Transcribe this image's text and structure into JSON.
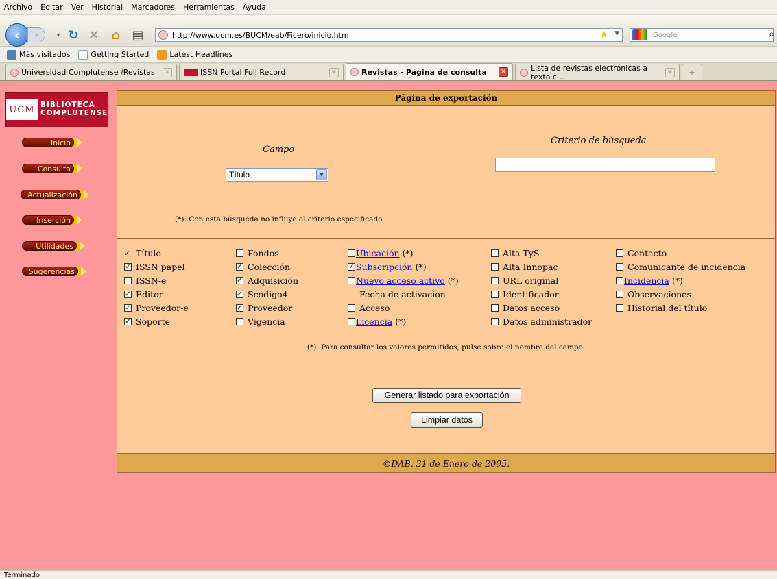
{
  "browser": {
    "menu": [
      "Archivo",
      "Editar",
      "Ver",
      "Historial",
      "Marcadores",
      "Herramientas",
      "Ayuda"
    ],
    "url": "http://www.ucm.es/BUCM/eab/Ficero/inicio.htm",
    "search_placeholder": "Google",
    "bookmarks": [
      "Más visitados",
      "Getting Started",
      "Latest Headlines"
    ],
    "tabs": [
      {
        "label": "Universidad Complutense /Revistas",
        "active": false
      },
      {
        "label": "ISSN Portal Full Record",
        "active": false
      },
      {
        "label": "Revistas - Página de consulta",
        "active": true
      },
      {
        "label": "Lista de revistas electrónicas a texto c...",
        "active": false
      }
    ],
    "status": "Terminado"
  },
  "logo": {
    "ucm": "UCM",
    "line1": "BIBLIOTECA",
    "line2": "COMPLUTENSE"
  },
  "nav": [
    "Inicio",
    "Consulta",
    "Actualización",
    "Inserción",
    "Utilidades",
    "Sugerencias"
  ],
  "page": {
    "title": "Página de exportación",
    "campo_label": "Campo",
    "campo_value": "Título",
    "criterio_label": "Criterio de búsqueda",
    "criterio_value": "",
    "note1": "(*): Con esta búsqueda no influye el criterio especificado",
    "note2": "(*): Para consultar los valores permitidos, pulse sobre el nombre del campo.",
    "export_button": "Generar listado para exportación",
    "clear_button": "Limpiar datos",
    "footer": "©DAB, 31 de Enero de 2005."
  },
  "fields": [
    [
      {
        "label": "Título",
        "state": "fixed"
      },
      {
        "label": "ISSN papel",
        "state": "checked"
      },
      {
        "label": "ISSN-e",
        "state": "unchecked"
      },
      {
        "label": "Editor",
        "state": "checked"
      },
      {
        "label": "Proveedor-e",
        "state": "checked"
      },
      {
        "label": "Soporte",
        "state": "checked"
      }
    ],
    [
      {
        "label": "Fondos",
        "state": "unchecked"
      },
      {
        "label": "Colección",
        "state": "checked"
      },
      {
        "label": "Adquisición",
        "state": "checked"
      },
      {
        "label": "Scódigo4",
        "state": "checked"
      },
      {
        "label": "Proveedor",
        "state": "checked"
      },
      {
        "label": "Vigencia",
        "state": "unchecked"
      }
    ],
    [
      {
        "label": "Ubicación",
        "state": "unchecked",
        "link": true,
        "suffix": "(*)"
      },
      {
        "label": "Subscripción",
        "state": "checked",
        "link": true,
        "suffix": "(*)"
      },
      {
        "label": "Nuevo acceso activo",
        "state": "unchecked",
        "link": true,
        "suffix": "(*)"
      },
      {
        "label": "Fecha de activación",
        "state": "none"
      },
      {
        "label": "Acceso",
        "state": "unchecked"
      },
      {
        "label": "Licencia",
        "state": "unchecked",
        "link": true,
        "suffix": "(*)"
      }
    ],
    [
      {
        "label": "Alta TyS",
        "state": "unchecked"
      },
      {
        "label": "Alta Innopac",
        "state": "unchecked"
      },
      {
        "label": "URL original",
        "state": "unchecked"
      },
      {
        "label": "Identificador",
        "state": "unchecked"
      },
      {
        "label": "Datos acceso",
        "state": "unchecked"
      },
      {
        "label": "Datos administrador",
        "state": "unchecked"
      }
    ],
    [
      {
        "label": "Contacto",
        "state": "unchecked"
      },
      {
        "label": "Comunicante de incidencia",
        "state": "unchecked"
      },
      {
        "label": "Incidencia",
        "state": "unchecked",
        "link": true,
        "suffix": "(*)"
      },
      {
        "label": "Observaciones",
        "state": "unchecked"
      },
      {
        "label": "Historial del título",
        "state": "unchecked"
      }
    ]
  ]
}
